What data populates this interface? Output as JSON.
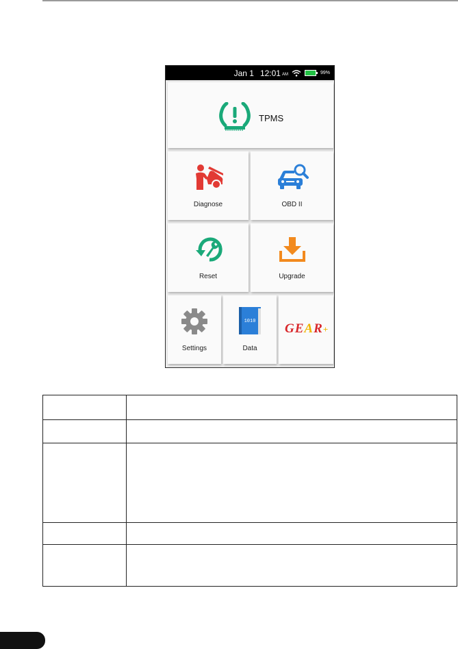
{
  "status_bar": {
    "date": "Jan 1",
    "time": "12:01",
    "ampm": "AM",
    "battery": "99%",
    "battery_color": "#22c144"
  },
  "tiles": {
    "tpms": {
      "label": "TPMS",
      "icon": "tire-pressure-warning-icon",
      "color": "#1aa979"
    },
    "diagnose": {
      "label": "Diagnose",
      "icon": "mechanic-car-icon",
      "color": "#e23a34"
    },
    "obd": {
      "label": "OBD II",
      "icon": "car-search-icon",
      "color": "#2b7fd8"
    },
    "reset": {
      "label": "Reset",
      "icon": "reset-wrench-icon",
      "color": "#1aa979"
    },
    "upgrade": {
      "label": "Upgrade",
      "icon": "download-icon",
      "color": "#f28a1e"
    },
    "settings": {
      "label": "Settings",
      "icon": "gear-icon",
      "color": "#8a8a8a"
    },
    "data": {
      "label": "Data",
      "icon": "data-book-icon",
      "color": "#2b7fd8"
    },
    "gear_plus": {
      "logo": {
        "g": "G",
        "e": "E",
        "a": "A",
        "r": "R",
        "plus": "+"
      }
    }
  },
  "table": {
    "rows": [
      {
        "col1": "",
        "col2": ""
      },
      {
        "col1": "",
        "col2": ""
      },
      {
        "col1": "",
        "col2": ""
      },
      {
        "col1": "",
        "col2": ""
      },
      {
        "col1": "",
        "col2": ""
      }
    ]
  },
  "page_number": ""
}
